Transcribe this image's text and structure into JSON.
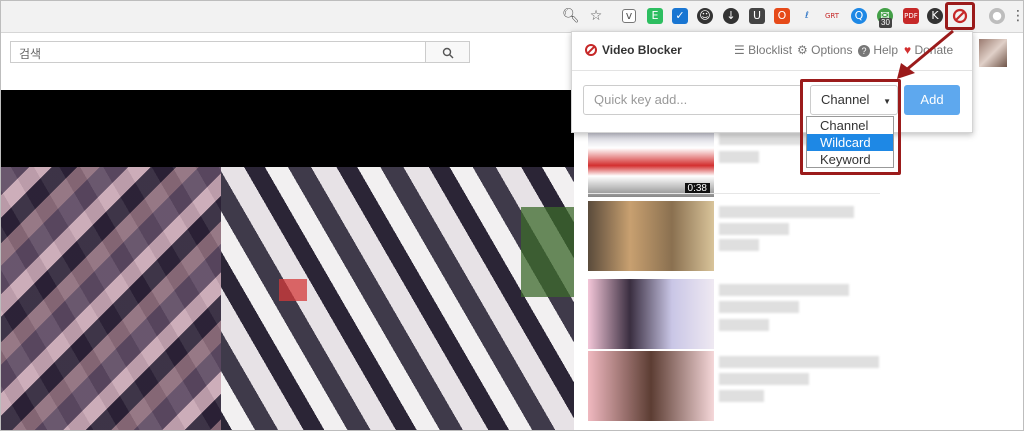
{
  "search": {
    "placeholder": "검색"
  },
  "popup": {
    "title": "Video Blocker",
    "nav": [
      {
        "label": "Blocklist",
        "icon": "list-icon"
      },
      {
        "label": "Options",
        "icon": "gear-icon"
      },
      {
        "label": "Help",
        "icon": "question-icon"
      },
      {
        "label": "Donate",
        "icon": "heart-icon"
      }
    ],
    "quick_placeholder": "Quick key add...",
    "select_value": "Channel",
    "add_label": "Add",
    "options": [
      "Channel",
      "Wildcard",
      "Keyword"
    ],
    "selected_option": "Wildcard"
  },
  "related": {
    "first_duration": "0:38"
  },
  "toolbar": {
    "badge": "30",
    "icons": [
      "zoom-icon",
      "star-icon",
      "pocket-icon",
      "evernote-icon",
      "todo-icon",
      "tamper-icon",
      "download-icon",
      "shield-icon",
      "office-icon",
      "text-icon",
      "ext-icon",
      "search-ext-icon",
      "ext-badge-icon",
      "pdf-icon",
      "k-icon",
      "video-blocker-icon",
      "profile-icon",
      "menu-icon"
    ]
  },
  "colors": {
    "accent": "#5ea8ee",
    "brand_red": "#c62828",
    "highlight_red": "#9b1b1b",
    "selected": "#1e88e5"
  }
}
